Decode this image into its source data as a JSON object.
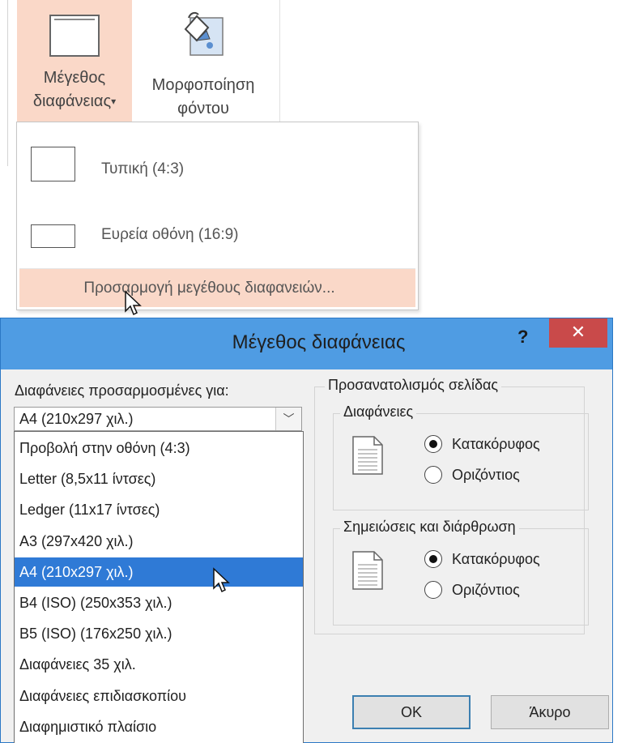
{
  "ribbon": {
    "slide_size": {
      "line1": "Μέγεθος",
      "line2": "διαφάνειας"
    },
    "format_background": {
      "line1": "Μορφοποίηση",
      "line2": "φόντου"
    }
  },
  "menu": {
    "standard": "Τυπική (4:3)",
    "widescreen": "Ευρεία οθόνη (16:9)",
    "custom": "Προσαρμογή μεγέθους διαφανειών..."
  },
  "dialog": {
    "title": "Μέγεθος διαφάνειας",
    "help": "?",
    "close": "✕",
    "sized_for_label": "Διαφάνειες προσαρμοσμένες για:",
    "sized_for_value": "A4 (210x297 χιλ.)",
    "options": [
      "Προβολή στην οθόνη (4:3)",
      "Letter (8,5x11 ίντσες)",
      "Ledger (11x17 ίντσες)",
      "A3 (297x420 χιλ.)",
      "A4 (210x297 χιλ.)",
      "B4 (ISO) (250x353 χιλ.)",
      "B5 (ISO) (176x250 χιλ.)",
      "Διαφάνειες 35 χιλ.",
      "Διαφάνειες επιδιασκοπίου",
      "Διαφημιστικό πλαίσιο"
    ],
    "selected_index": 4,
    "orientation": {
      "title": "Προσανατολισμός σελίδας",
      "slides": {
        "title": "Διαφάνειες",
        "portrait": "Κατακόρυφος",
        "landscape": "Οριζόντιος",
        "selected": "portrait"
      },
      "notes": {
        "title": "Σημειώσεις και διάρθρωση",
        "portrait": "Κατακόρυφος",
        "landscape": "Οριζόντιος",
        "selected": "portrait"
      }
    },
    "ok": "OK",
    "cancel": "Άκυρο"
  },
  "colors": {
    "hover": "#fad8c8",
    "titlebar": "#4f9ce3",
    "close": "#c94a4a",
    "selection": "#2f7ad6"
  }
}
